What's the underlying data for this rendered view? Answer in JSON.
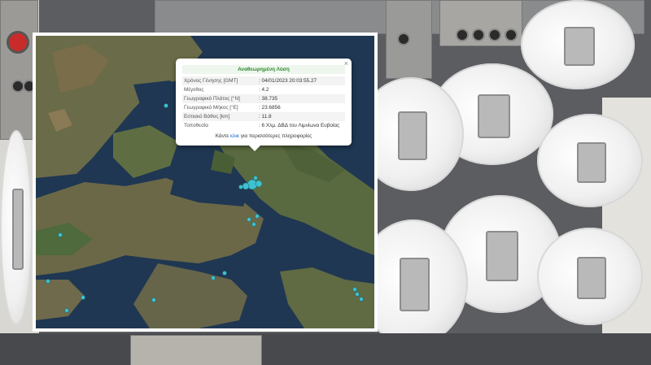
{
  "popup": {
    "title": "Αναθεωρημένη Λύση",
    "close_icon": "×",
    "rows": [
      {
        "label": "Χρόνος Γένησης [GMT]",
        "value": ": 04/01/2023 20:03:55.27"
      },
      {
        "label": "Μέγεθος",
        "value": ": 4.2"
      },
      {
        "label": "Γεωγραφικό Πλάτος [°N]",
        "value": ": 38.735"
      },
      {
        "label": "Γεωγραφικό Μήκος [°E]",
        "value": ": 23.6856"
      },
      {
        "label": "Εστιακό Βάθος [km]",
        "value": ": 11.8"
      },
      {
        "label": "Τοποθεσία",
        "value": ": 6 Χλμ. ΔΒΔ του Λιμνίωνα Ευβοίας"
      }
    ],
    "footer_pre": "Κάντε ",
    "footer_link": "κλικ",
    "footer_post": " για περισσότερες πληροφορίες"
  },
  "colors": {
    "sea": "#1f3752",
    "land": "#5e6b45",
    "marker": "#3fc1cf",
    "title_green": "#2e8b2e",
    "link_blue": "#1565c0"
  }
}
